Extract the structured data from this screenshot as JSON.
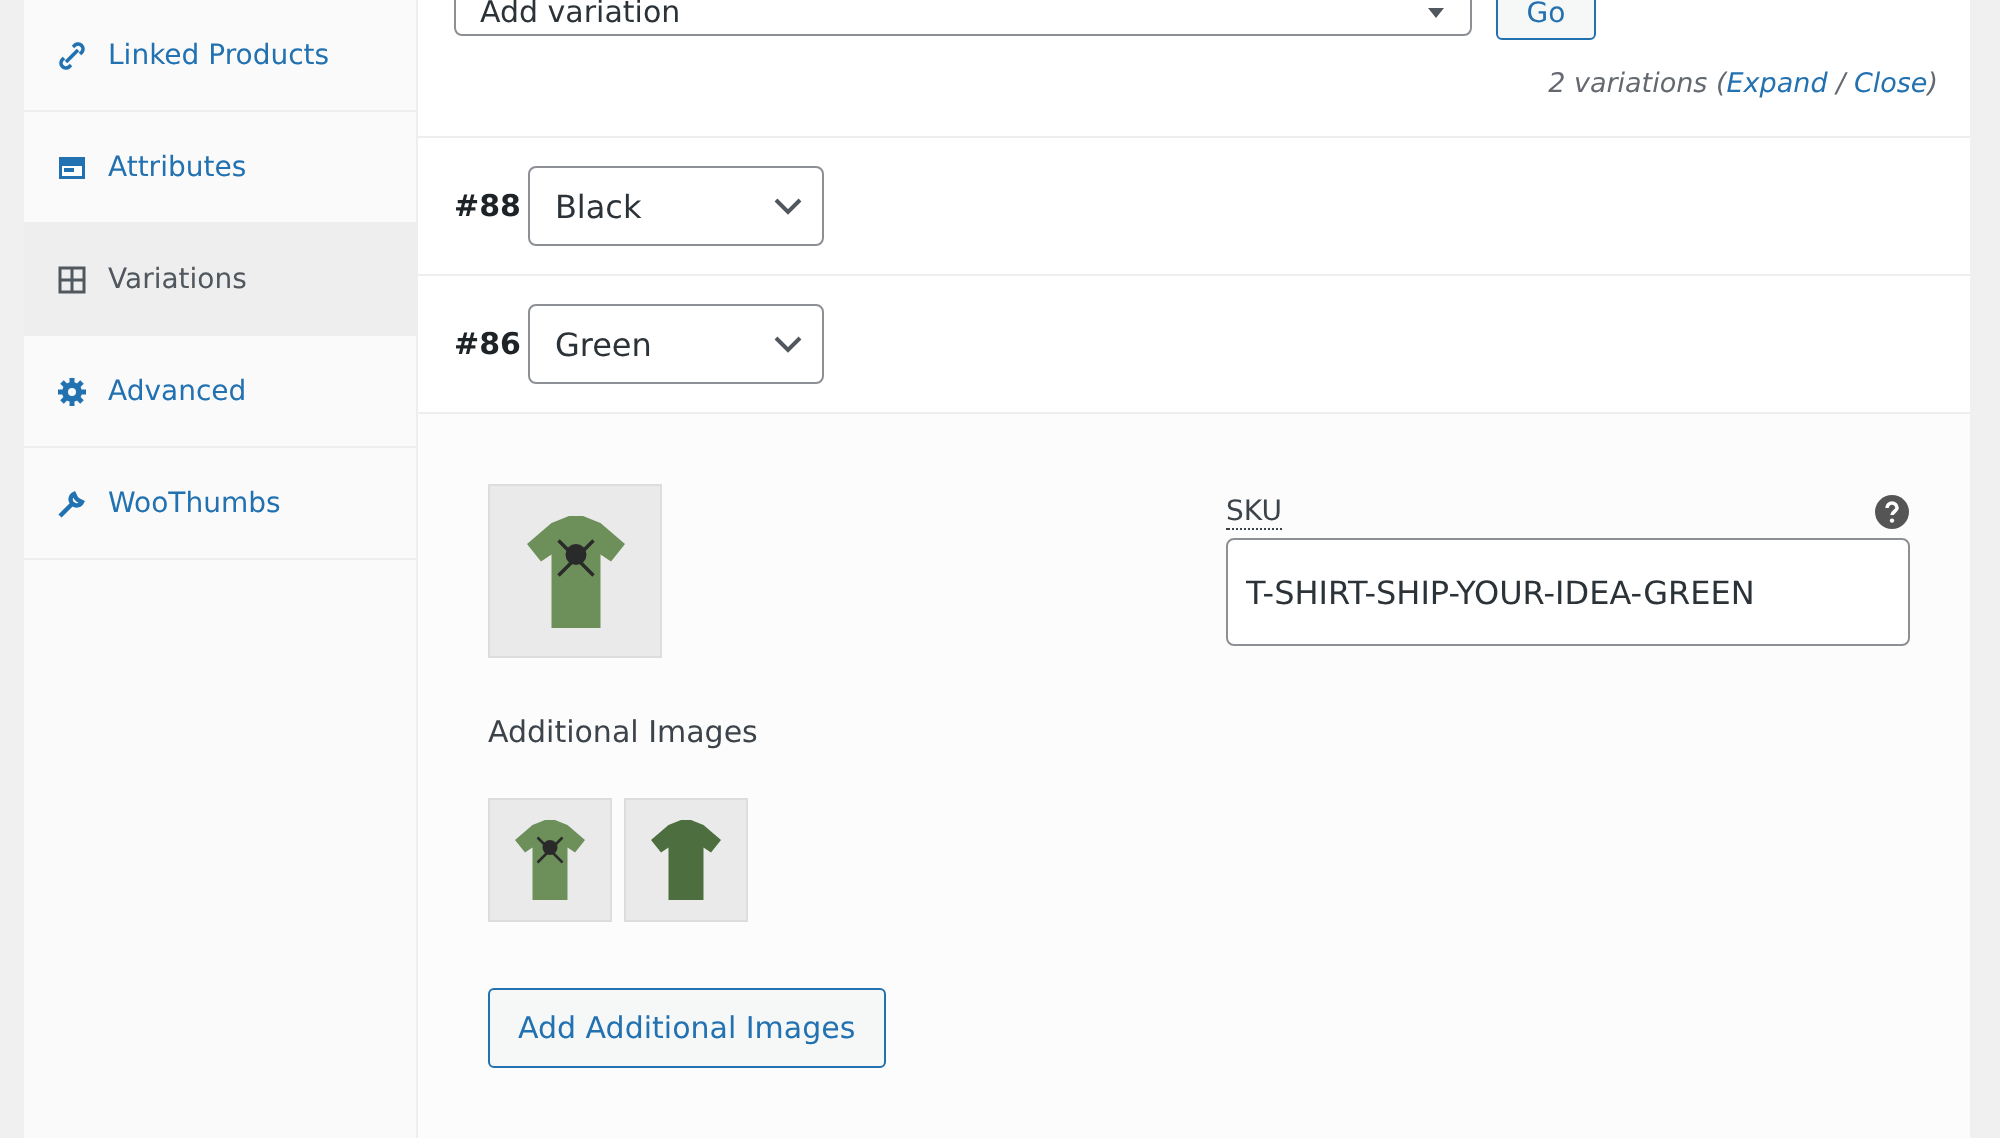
{
  "sidebar": {
    "items": [
      {
        "label": "Linked Products",
        "selected": false
      },
      {
        "label": "Attributes",
        "selected": false
      },
      {
        "label": "Variations",
        "selected": true
      },
      {
        "label": "Advanced",
        "selected": false
      },
      {
        "label": "WooThumbs",
        "selected": false
      }
    ]
  },
  "toolbar": {
    "select_value": "Add variation",
    "go_button": "Go",
    "count": "2 variations",
    "open_paren": "(",
    "expand_link": "Expand",
    "separator": "/",
    "close_link": "Close",
    "close_paren": ")"
  },
  "variations": [
    {
      "id": "#88",
      "value": "Black"
    },
    {
      "id": "#86",
      "value": "Green"
    }
  ],
  "details": {
    "sku_label": "SKU",
    "sku_value": "T-SHIRT-SHIP-YOUR-IDEA-GREEN",
    "additional_images_label": "Additional Images",
    "additional_images": [
      {
        "kind": "front"
      },
      {
        "kind": "back"
      }
    ],
    "add_button": "Add Additional Images"
  }
}
